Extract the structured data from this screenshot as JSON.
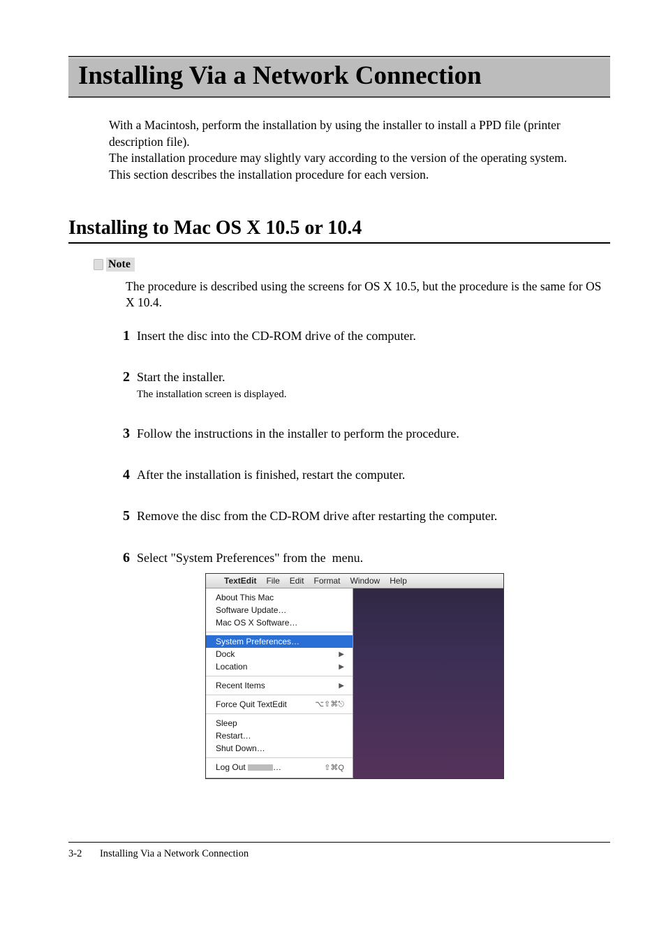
{
  "title": "Installing Via a Network Connection",
  "intro": {
    "p1": "With a Macintosh, perform the installation by using the installer to install a PPD file (printer description file).",
    "p2": "The installation procedure may slightly vary according to the version of the operating system.",
    "p3": "This section describes the installation procedure for each version."
  },
  "section_heading": "Installing to Mac OS X 10.5 or 10.4",
  "note": {
    "label": "Note",
    "text": "The procedure is described using the screens for OS X 10.5, but the procedure is the same for OS X 10.4."
  },
  "steps": [
    {
      "n": "1",
      "title": "Insert the disc into the CD-ROM drive of the computer."
    },
    {
      "n": "2",
      "title": "Start the installer.",
      "sub": "The installation screen is displayed."
    },
    {
      "n": "3",
      "title": "Follow the instructions in the installer to perform the procedure."
    },
    {
      "n": "4",
      "title": "After the installation is finished, restart the computer."
    },
    {
      "n": "5",
      "title": "Remove the disc from the CD-ROM drive after restarting the computer."
    },
    {
      "n": "6",
      "title_pre": "Select \"System Preferences\" from the ",
      "title_post": " menu."
    }
  ],
  "menubar": {
    "app": "TextEdit",
    "items": [
      "File",
      "Edit",
      "Format",
      "Window",
      "Help"
    ]
  },
  "dropdown": {
    "g1": [
      "About This Mac",
      "Software Update…",
      "Mac OS X Software…"
    ],
    "selected": "System Preferences…",
    "g2": [
      {
        "label": "Dock",
        "arrow": true
      },
      {
        "label": "Location",
        "arrow": true
      }
    ],
    "g3": [
      {
        "label": "Recent Items",
        "arrow": true
      }
    ],
    "g4": [
      {
        "label": "Force Quit TextEdit",
        "shortcut": "⌥⇧⌘⎋"
      }
    ],
    "g5": [
      "Sleep",
      "Restart…",
      "Shut Down…"
    ],
    "logout": {
      "label": "Log Out ",
      "shortcut": "⇧⌘Q"
    }
  },
  "footer": {
    "page": "3-2",
    "label": "Installing Via a Network Connection"
  }
}
